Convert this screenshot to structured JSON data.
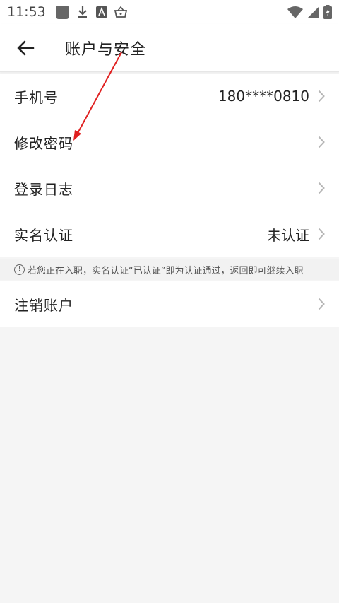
{
  "status_bar": {
    "time": "11:53",
    "icons": [
      "app-square-icon",
      "download-icon",
      "font-app-icon",
      "basket-icon",
      "wifi-icon",
      "signal-icon",
      "battery-icon"
    ]
  },
  "header": {
    "back_icon": "arrow-left-icon",
    "title": "账户与安全"
  },
  "rows": [
    {
      "label": "手机号",
      "value": "180****0810"
    },
    {
      "label": "修改密码",
      "value": ""
    },
    {
      "label": "登录日志",
      "value": ""
    },
    {
      "label": "实名认证",
      "value": "未认证"
    }
  ],
  "notice": {
    "text": "若您正在入职，实名认证“已认证”即为认证通过，返回即可继续入职"
  },
  "rows2": [
    {
      "label": "注销账户"
    }
  ],
  "colors": {
    "annotation_arrow": "#e02020",
    "background": "#f5f5f5"
  }
}
